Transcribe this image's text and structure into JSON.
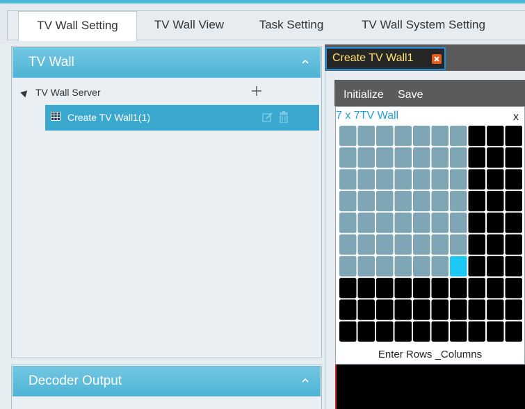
{
  "tabs": [
    {
      "label": "TV Wall Setting",
      "active": true
    },
    {
      "label": "TV Wall View",
      "active": false
    },
    {
      "label": "Task Setting",
      "active": false
    },
    {
      "label": "TV Wall System Setting",
      "active": false
    }
  ],
  "left_panel": {
    "title": "TV Wall",
    "tree": {
      "root_label": "TV Wall Server",
      "items": [
        {
          "label": "Create TV Wall1(1)"
        }
      ]
    }
  },
  "decoder_panel": {
    "title": "Decoder Output"
  },
  "wall_tab": {
    "label": "Create TV Wall1"
  },
  "editor": {
    "initialize_label": "Initialize",
    "save_label": "Save"
  },
  "wall_popup": {
    "title": "7 x 7TV Wall",
    "close_label": "x",
    "footer_label": "Enter Rows _Columns",
    "grid_rows": 10,
    "grid_cols": 10,
    "selected_rows": 7,
    "selected_cols": 7
  },
  "colors": {
    "accent": "#4fb3d5",
    "selected_cell": "#7fa6b5",
    "active_cell": "#1ec8f5",
    "empty_cell": "#000000"
  }
}
